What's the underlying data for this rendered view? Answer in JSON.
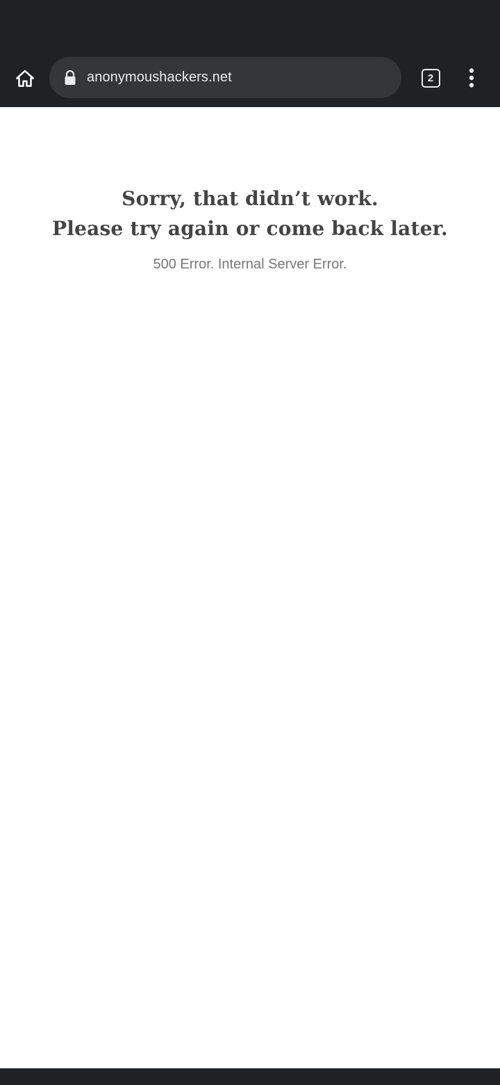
{
  "browser": {
    "url": "anonymoushackers.net",
    "tab_count": "2",
    "icons": {
      "home": "home-icon",
      "lock": "lock-icon",
      "tabs": "tab-switcher-icon",
      "menu": "more-vert-icon"
    }
  },
  "error_page": {
    "headline_line1": "Sorry, that didn’t work.",
    "headline_line2": "Please try again or come back later.",
    "error_code": "500 Error. Internal Server Error."
  },
  "colors": {
    "chrome_bar": "#202124",
    "omnibox": "#35363a",
    "headline_text": "#444444",
    "subtext": "#777777"
  }
}
